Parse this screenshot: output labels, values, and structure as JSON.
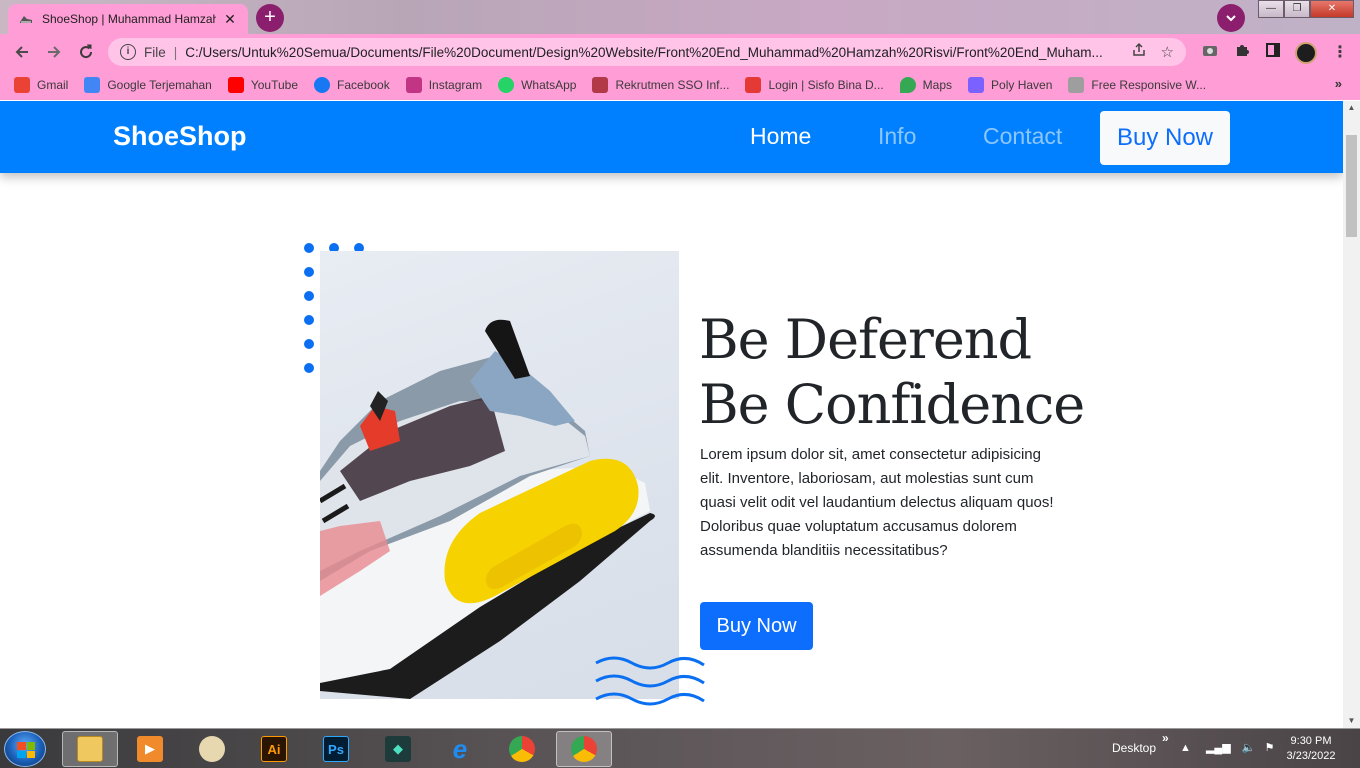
{
  "browser": {
    "tab_title": "ShoeShop | Muhammad Hamzah",
    "tab_close": "✕",
    "new_tab": "+",
    "url_scheme": "File",
    "url": "C:/Users/Untuk%20Semua/Documents/File%20Document/Design%20Website/Front%20End_Muhammad%20Hamzah%20Risvi/Front%20End_Muham...",
    "bookmarks": [
      {
        "label": "Gmail",
        "color": "#ea4335"
      },
      {
        "label": "Google Terjemahan",
        "color": "#4285f4"
      },
      {
        "label": "YouTube",
        "color": "#ff0000"
      },
      {
        "label": "Facebook",
        "color": "#1877f2"
      },
      {
        "label": "Instagram",
        "color": "#c13584"
      },
      {
        "label": "WhatsApp",
        "color": "#25d366"
      },
      {
        "label": "Rekrutmen SSO Inf...",
        "color": "#b23a48"
      },
      {
        "label": "Login | Sisfo Bina D...",
        "color": "#e53935"
      },
      {
        "label": "Maps",
        "color": "#34a853"
      },
      {
        "label": "Poly Haven",
        "color": "#7b61ff"
      },
      {
        "label": "Free Responsive W...",
        "color": "#9e9e9e"
      }
    ],
    "bookmarks_more": "»"
  },
  "navbar": {
    "brand": "ShoeShop",
    "links": {
      "home": "Home",
      "info": "Info",
      "contact": "Contact"
    },
    "buy_label": "Buy Now",
    "color": "#0080ff"
  },
  "hero": {
    "title_line1": "Be Deferend",
    "title_line2": "Be Confidence",
    "text": "Lorem ipsum dolor sit, amet consectetur adipisicing elit. Inventore, laboriosam, aut molestias sunt cum quasi velit odit vel laudantium delectus aliquam quos! Doloribus quae voluptatum accusamus dolorem assumenda blanditiis necessitatibus?",
    "button_label": "Buy Now",
    "button_color": "#0d6efd"
  },
  "taskbar": {
    "desktop_label": "Desktop",
    "time": "9:30 PM",
    "date": "3/23/2022",
    "apps": [
      "explorer",
      "media-player",
      "paint",
      "illustrator",
      "photoshop",
      "filmora",
      "internet-explorer",
      "chrome",
      "chrome-active"
    ],
    "illustrator_label": "Ai",
    "photoshop_label": "Ps"
  }
}
